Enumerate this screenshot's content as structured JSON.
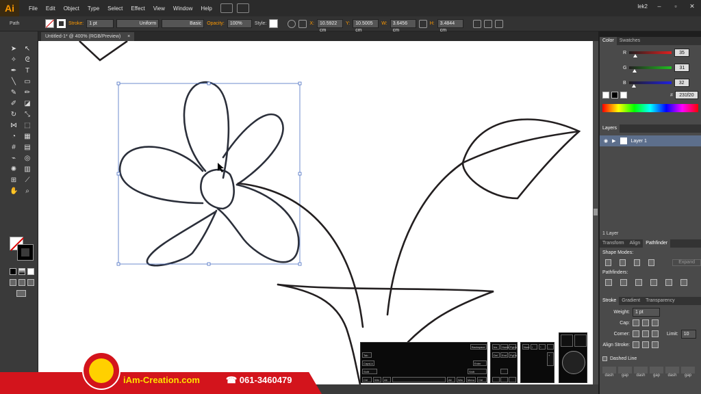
{
  "app": {
    "logo": "Ai",
    "menus": [
      "File",
      "Edit",
      "Object",
      "Type",
      "Select",
      "Effect",
      "View",
      "Window",
      "Help"
    ],
    "user": "lek2",
    "window_controls": [
      "–",
      "▫",
      "✕"
    ]
  },
  "control_bar": {
    "selection_type": "Path",
    "stroke_label": "Stroke:",
    "stroke_weight": "1 pt",
    "profile": "Uniform",
    "brush": "Basic",
    "opacity_label": "Opacity:",
    "opacity": "100%",
    "style_label": "Style:",
    "x_label": "X:",
    "x": "10.5922 cm",
    "y_label": "Y:",
    "y": "10.5005 cm",
    "w_label": "W:",
    "w": "3.6456 cm",
    "h_label": "H:",
    "h": "3.4844 cm"
  },
  "document_tab": {
    "title": "Untitled-1* @ 400% (RGB/Preview)",
    "close": "×"
  },
  "color_panel": {
    "tabs": [
      "Color",
      "Swatches"
    ],
    "channels": [
      {
        "label": "R",
        "value": "35",
        "fraction": 0.137,
        "color": "#e02020"
      },
      {
        "label": "G",
        "value": "31",
        "fraction": 0.122,
        "color": "#20c020"
      },
      {
        "label": "B",
        "value": "32",
        "fraction": 0.125,
        "color": "#2020e0"
      }
    ],
    "hex_label": "#",
    "hex": "231f20"
  },
  "layers_panel": {
    "title": "Layers",
    "layer_name": "Layer 1",
    "footer": "1 Layer"
  },
  "transform_panel": {
    "tabs": [
      "Transform",
      "Align",
      "Pathfinder"
    ],
    "shape_modes": "Shape Modes:",
    "expand": "Expand",
    "pathfinders": "Pathfinders:"
  },
  "stroke_panel": {
    "tabs": [
      "Stroke",
      "Gradient",
      "Transparency"
    ],
    "weight_label": "Weight:",
    "weight": "1 pt",
    "cap_label": "Cap:",
    "corner_label": "Corner:",
    "limit_label": "Limit:",
    "limit": "10",
    "align_label": "Align Stroke:",
    "dashed_label": "Dashed Line",
    "dash_labels": [
      "dash",
      "gap",
      "dash",
      "gap",
      "dash",
      "gap"
    ]
  },
  "branding": {
    "site": "iAm-Creation.com",
    "phone": "☎ 061-3460479"
  },
  "keyboard_overlay": {
    "keys": [
      "Tab",
      "CapsLk",
      "Shift",
      "Ctrl",
      "Win",
      "Alt",
      "Alt",
      "Win",
      "Menu",
      "Ctrl",
      "Backspace",
      "Enter",
      "Shift",
      "Ins",
      "Home",
      "PgUp",
      "Del",
      "End",
      "PgDn",
      "Num",
      "/",
      "*",
      "-",
      "+"
    ]
  },
  "colors": {
    "accent": "#ff9a00",
    "canvas": "#ffffff",
    "stroke": "#231f20",
    "brand_red": "#d3141c",
    "brand_yellow": "#ffe000",
    "selection": "#4a6fc2"
  }
}
